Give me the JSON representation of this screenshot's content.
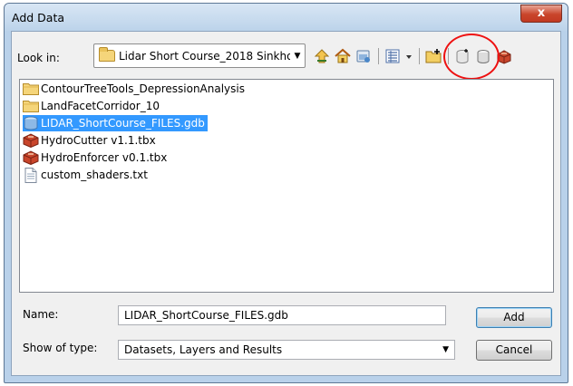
{
  "window": {
    "title": "Add Data",
    "close_label": "x"
  },
  "lookin": {
    "label": "Look in:",
    "value": "Lidar Short Course_2018 Sinkho"
  },
  "toolbar": {
    "icons": [
      "up-one-level-icon",
      "home-icon",
      "connect-folder-icon",
      "list-view-icon",
      "view-options-dropdown-icon",
      "new-folder-icon",
      "new-file-gdb-icon",
      "new-personal-gdb-icon",
      "new-toolbox-icon"
    ]
  },
  "files": [
    {
      "name": "ContourTreeTools_DepressionAnalysis",
      "type": "folder",
      "selected": false
    },
    {
      "name": "LandFacetCorridor_10",
      "type": "folder",
      "selected": false
    },
    {
      "name": "LIDAR_ShortCourse_FILES.gdb",
      "type": "geodatabase",
      "selected": true
    },
    {
      "name": "HydroCutter v1.1.tbx",
      "type": "toolbox",
      "selected": false
    },
    {
      "name": "HydroEnforcer v0.1.tbx",
      "type": "toolbox",
      "selected": false
    },
    {
      "name": "custom_shaders.txt",
      "type": "text",
      "selected": false
    }
  ],
  "name": {
    "label": "Name:",
    "value": "LIDAR_ShortCourse_FILES.gdb"
  },
  "show_type": {
    "label": "Show of type:",
    "value": "Datasets, Layers and Results"
  },
  "buttons": {
    "add": "Add",
    "cancel": "Cancel"
  },
  "colors": {
    "selection": "#3399ff",
    "annotation_circle": "#e11111",
    "close_button": "#c9452b"
  }
}
